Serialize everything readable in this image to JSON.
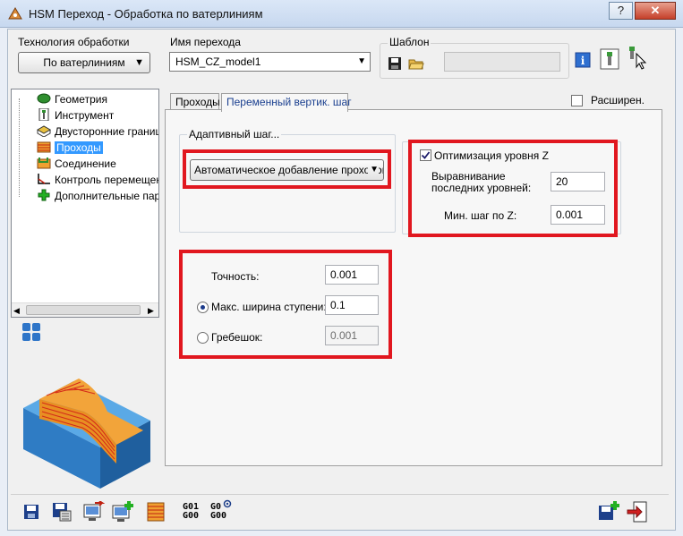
{
  "window": {
    "title": "HSM Переход - Обработка по ватерлиниям",
    "help": "?",
    "close": "✕"
  },
  "header": {
    "tech_label": "Технология обработки",
    "tech_value": "По ватерлиниям",
    "pass_name_label": "Имя перехода",
    "pass_name_value": "HSM_CZ_model1",
    "template_label": "Шаблон"
  },
  "tree": {
    "items": [
      {
        "label": "Геометрия",
        "icon": "geometry-icon"
      },
      {
        "label": "Инструмент",
        "icon": "tool-icon"
      },
      {
        "label": "Двусторонние границы",
        "icon": "boundary-icon"
      },
      {
        "label": "Проходы",
        "icon": "passes-icon",
        "selected": true
      },
      {
        "label": "Соединение",
        "icon": "links-icon"
      },
      {
        "label": "Контроль перемещений",
        "icon": "motion-control-icon"
      },
      {
        "label": "Дополнительные параметры",
        "icon": "plus-icon"
      }
    ]
  },
  "tabs": [
    "Проходы",
    "Переменный вертик. шаг"
  ],
  "extended": {
    "label": "Расширен."
  },
  "adaptive": {
    "title": "Адаптивный шаг...",
    "value": "Автоматическое добавление проходов"
  },
  "optimization": {
    "checkbox_label": "Оптимизация уровня Z",
    "align_label_1": "Выравнивание",
    "align_label_2": "последних  уровней:",
    "align_value": "20",
    "min_step_label": "Мин. шаг по Z:",
    "min_step_value": "0.001"
  },
  "precision": {
    "accuracy_label": "Точность:",
    "accuracy_value": "0.001",
    "max_width_label": "Макс. ширина ступени:",
    "max_width_value": "0.1",
    "scallop_label": "Гребешок:",
    "scallop_value": "0.001"
  },
  "bottom": {
    "g1": "G01",
    "g2": "G00",
    "g3": "G0",
    "g4": "G00"
  },
  "colors": {
    "accent_red": "#e1171f",
    "selection": "#3399ff",
    "tab_active_text": "#1a3f8f"
  }
}
